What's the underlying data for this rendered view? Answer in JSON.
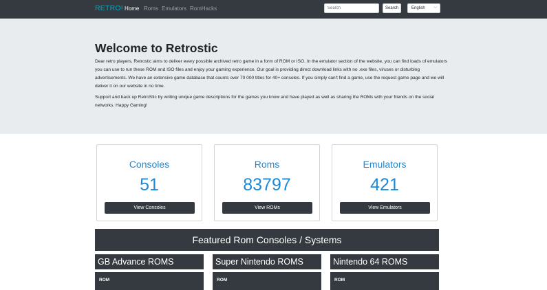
{
  "navbar": {
    "brand": "RETRO!",
    "links": [
      "Home",
      "Roms",
      "Emulators",
      "RomHacks"
    ],
    "search_placeholder": "Search",
    "search_button": "Search",
    "language": "English"
  },
  "jumbotron": {
    "title": "Welcome to Retrostic",
    "paragraph1": "Dear retro players, Retrostic aims to deliver every possible archived retro game in a form of ROM or ISO. In the emulator section of the website, you can find loads of emulators you can use to run these ROM and ISO files and enjoy your gaming experience. Our goal is providing direct download links with no .exe files, viruses or disturbing advertisements. We have an extensive game database that counts over 70 000 titles for 40+ consoles. If you simply can't find a game, use the request game page and we will deliver it on our website in no time.",
    "paragraph2": "Support and back up RetroStic by writing unique game descriptions for the games you know and have played as well as sharing the ROMs with your friends on the social networks. Happy Gaming!"
  },
  "cards": [
    {
      "title": "Consoles",
      "count": "51",
      "button": "View Consoles"
    },
    {
      "title": "Roms",
      "count": "83797",
      "button": "View ROMs"
    },
    {
      "title": "Emulators",
      "count": "421",
      "button": "View Emulators"
    }
  ],
  "featured": {
    "heading": "Featured Rom Consoles / Systems",
    "consoles": [
      {
        "name": "GB Advance ROMS",
        "sub": "ROM"
      },
      {
        "name": "Super Nintendo ROMS",
        "sub": "ROM"
      },
      {
        "name": "Nintendo 64 ROMS",
        "sub": "ROM"
      }
    ]
  },
  "colors": {
    "navbar": "#343a40",
    "brand": "#17a2b8",
    "accent": "#1a8ad9",
    "jumbotron": "#e9ecef"
  }
}
